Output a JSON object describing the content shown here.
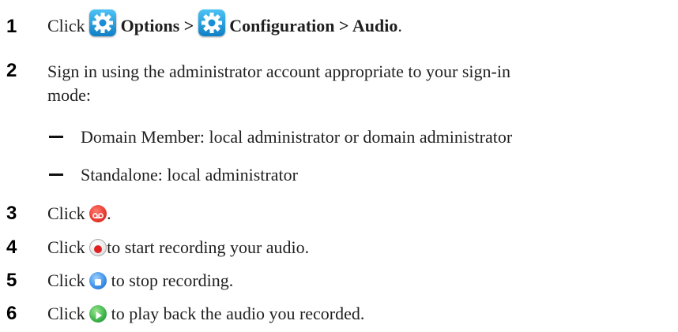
{
  "steps": [
    {
      "number": "1",
      "click": "Click",
      "options_label": "Options >",
      "configuration_label": "Configuration > Audio",
      "period": "."
    },
    {
      "number": "2",
      "line1": "Sign in using the administrator account appropriate to your sign-in",
      "line2": "mode:",
      "bullets": [
        "Domain Member: local administrator or domain administrator",
        "Standalone: local administrator"
      ]
    },
    {
      "number": "3",
      "click": "Click",
      "after": "."
    },
    {
      "number": "4",
      "click": "Click",
      "after": "to start recording your audio."
    },
    {
      "number": "5",
      "click": "Click",
      "after": " to stop recording."
    },
    {
      "number": "6",
      "click": "Click",
      "after": " to play back the audio you recorded."
    }
  ],
  "icons": {
    "gear": "gear-icon",
    "voicemail": "voicemail-icon",
    "record": "record-icon",
    "stop": "stop-icon",
    "play": "play-icon"
  },
  "colors": {
    "gear_blue": "#1a8fd6",
    "voicemail_red": "#e8392f",
    "record_red": "#e02020",
    "stop_blue": "#3a8ee6",
    "play_green": "#3bb34a"
  }
}
